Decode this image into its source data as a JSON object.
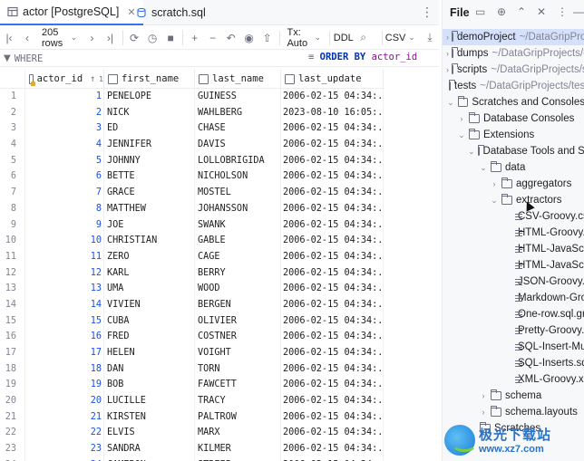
{
  "tabs": [
    {
      "label": "actor [PostgreSQL]",
      "icon": "table-icon",
      "active": true
    },
    {
      "label": "scratch.sql",
      "icon": "sql-file-icon",
      "active": false
    }
  ],
  "toolbar": {
    "rows_label": "205 rows",
    "tx_label": "Tx: Auto",
    "ddl_label": "DDL",
    "format_label": "CSV"
  },
  "filter": {
    "where_label": "WHERE",
    "order_by_keyword": "ORDER BY",
    "order_by_column": "actor_id"
  },
  "grid": {
    "columns": [
      "actor_id",
      "first_name",
      "last_name",
      "last_update"
    ],
    "sort_indicator": "↑",
    "sort_number": "1",
    "rows": [
      [
        "1",
        "1",
        "PENELOPE",
        "GUINESS",
        "2006-02-15 04:34:.."
      ],
      [
        "2",
        "2",
        "NICK",
        "WAHLBERG",
        "2023-08-10 16:05:.."
      ],
      [
        "3",
        "3",
        "ED",
        "CHASE",
        "2006-02-15 04:34:.."
      ],
      [
        "4",
        "4",
        "JENNIFER",
        "DAVIS",
        "2006-02-15 04:34:.."
      ],
      [
        "5",
        "5",
        "JOHNNY",
        "LOLLOBRIGIDA",
        "2006-02-15 04:34:.."
      ],
      [
        "6",
        "6",
        "BETTE",
        "NICHOLSON",
        "2006-02-15 04:34:.."
      ],
      [
        "7",
        "7",
        "GRACE",
        "MOSTEL",
        "2006-02-15 04:34:.."
      ],
      [
        "8",
        "8",
        "MATTHEW",
        "JOHANSSON",
        "2006-02-15 04:34:.."
      ],
      [
        "9",
        "9",
        "JOE",
        "SWANK",
        "2006-02-15 04:34:.."
      ],
      [
        "10",
        "10",
        "CHRISTIAN",
        "GABLE",
        "2006-02-15 04:34:.."
      ],
      [
        "11",
        "11",
        "ZERO",
        "CAGE",
        "2006-02-15 04:34:.."
      ],
      [
        "12",
        "12",
        "KARL",
        "BERRY",
        "2006-02-15 04:34:.."
      ],
      [
        "13",
        "13",
        "UMA",
        "WOOD",
        "2006-02-15 04:34:.."
      ],
      [
        "14",
        "14",
        "VIVIEN",
        "BERGEN",
        "2006-02-15 04:34:.."
      ],
      [
        "15",
        "15",
        "CUBA",
        "OLIVIER",
        "2006-02-15 04:34:.."
      ],
      [
        "16",
        "16",
        "FRED",
        "COSTNER",
        "2006-02-15 04:34:.."
      ],
      [
        "17",
        "17",
        "HELEN",
        "VOIGHT",
        "2006-02-15 04:34:.."
      ],
      [
        "18",
        "18",
        "DAN",
        "TORN",
        "2006-02-15 04:34:.."
      ],
      [
        "19",
        "19",
        "BOB",
        "FAWCETT",
        "2006-02-15 04:34:.."
      ],
      [
        "20",
        "20",
        "LUCILLE",
        "TRACY",
        "2006-02-15 04:34:.."
      ],
      [
        "21",
        "21",
        "KIRSTEN",
        "PALTROW",
        "2006-02-15 04:34:.."
      ],
      [
        "22",
        "22",
        "ELVIS",
        "MARX",
        "2006-02-15 04:34:.."
      ],
      [
        "23",
        "23",
        "SANDRA",
        "KILMER",
        "2006-02-15 04:34:.."
      ],
      [
        "24",
        "24",
        "CAMERON",
        "STREEP",
        "2006-02-15 04:34:.."
      ]
    ]
  },
  "project": {
    "title": "File",
    "items": [
      {
        "label": "demoProject",
        "path": "~/DataGripProjects/demoProject",
        "kind": "folder",
        "chevron": "›",
        "selected": true
      },
      {
        "label": "dumps",
        "path": "~/DataGripProjects/dumps",
        "kind": "folder",
        "chevron": "›",
        "selected": false
      },
      {
        "label": "scripts",
        "path": "~/DataGripProjects/scripts",
        "kind": "folder",
        "chevron": "›",
        "selected": false
      },
      {
        "label": "tests",
        "path": "~/DataGripProjects/tests",
        "kind": "folder",
        "chevron": "",
        "selected": false
      },
      {
        "label": "Scratches and Consoles",
        "path": "",
        "kind": "folder",
        "chevron": "⌄",
        "selected": false
      },
      {
        "label": "Database Consoles",
        "path": "",
        "kind": "folder",
        "chevron": "›",
        "selected": false
      },
      {
        "label": "Extensions",
        "path": "",
        "kind": "folder",
        "chevron": "⌄",
        "selected": false
      },
      {
        "label": "Database Tools and SQL",
        "path": "",
        "kind": "folder",
        "chevron": "⌄",
        "selected": false
      },
      {
        "label": "data",
        "path": "",
        "kind": "folder",
        "chevron": "⌄",
        "selected": false
      },
      {
        "label": "aggregators",
        "path": "",
        "kind": "folder",
        "chevron": "›",
        "selected": false
      },
      {
        "label": "extractors",
        "path": "",
        "kind": "folder",
        "chevron": "⌄",
        "selected": false
      },
      {
        "label": "CSV-Groovy.csv.groovy",
        "path": "",
        "kind": "file",
        "chevron": "",
        "selected": false
      },
      {
        "label": "HTML-Groovy.html.groovy",
        "path": "",
        "kind": "file",
        "chevron": "",
        "selected": false
      },
      {
        "label": "HTML-JavaScript.html.js",
        "path": "",
        "kind": "file",
        "chevron": "",
        "selected": false
      },
      {
        "label": "HTML-JavaScript.js",
        "path": "",
        "kind": "file",
        "chevron": "",
        "selected": false
      },
      {
        "label": "JSON-Groovy.json.groovy",
        "path": "",
        "kind": "file",
        "chevron": "",
        "selected": false
      },
      {
        "label": "Markdown-Groovy.md.groovy",
        "path": "",
        "kind": "file",
        "chevron": "",
        "selected": false
      },
      {
        "label": "One-row.sql.groovy",
        "path": "",
        "kind": "file",
        "chevron": "",
        "selected": false
      },
      {
        "label": "Pretty-Groovy.txt.groovy",
        "path": "",
        "kind": "file",
        "chevron": "",
        "selected": false
      },
      {
        "label": "SQL-Insert-Multirow.sql.groovy",
        "path": "",
        "kind": "file",
        "chevron": "",
        "selected": false
      },
      {
        "label": "SQL-Inserts.sql.groovy",
        "path": "",
        "kind": "file",
        "chevron": "",
        "selected": false
      },
      {
        "label": "XML-Groovy.xml.groovy",
        "path": "",
        "kind": "file",
        "chevron": "",
        "selected": false
      },
      {
        "label": "schema",
        "path": "",
        "kind": "folder",
        "chevron": "›",
        "selected": false
      },
      {
        "label": "schema.layouts",
        "path": "",
        "kind": "folder",
        "chevron": "›",
        "selected": false
      },
      {
        "label": "Scratches",
        "path": "",
        "kind": "folder",
        "chevron": "",
        "selected": false
      }
    ]
  },
  "watermark": {
    "cn_text": "极光下载站",
    "url": "www.xz7.com"
  }
}
